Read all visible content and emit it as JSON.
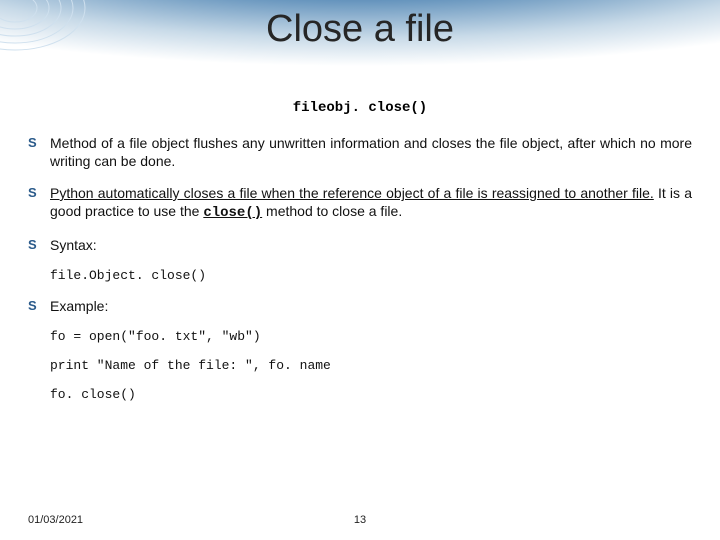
{
  "title": "Close a file",
  "code_header": "fileobj. close()",
  "bullets": {
    "b1": "Method of a file object flushes any unwritten information and closes the file object, after which no more writing can be done.",
    "b2_u": "Python automatically closes a file when the reference object of a file is reassigned to another file.",
    "b2_rest": " It is a good practice to use the ",
    "b2_mono": "close()",
    "b2_tail": " method to close a file.",
    "b3": "Syntax:",
    "b4": "Example:"
  },
  "code": {
    "syntax": "file.Object. close()",
    "ex1": "fo = open(\"foo. txt\", \"wb\")",
    "ex2": "print \"Name of the file: \", fo. name",
    "ex3": "fo. close()"
  },
  "footer": {
    "date": "01/03/2021",
    "page": "13"
  }
}
